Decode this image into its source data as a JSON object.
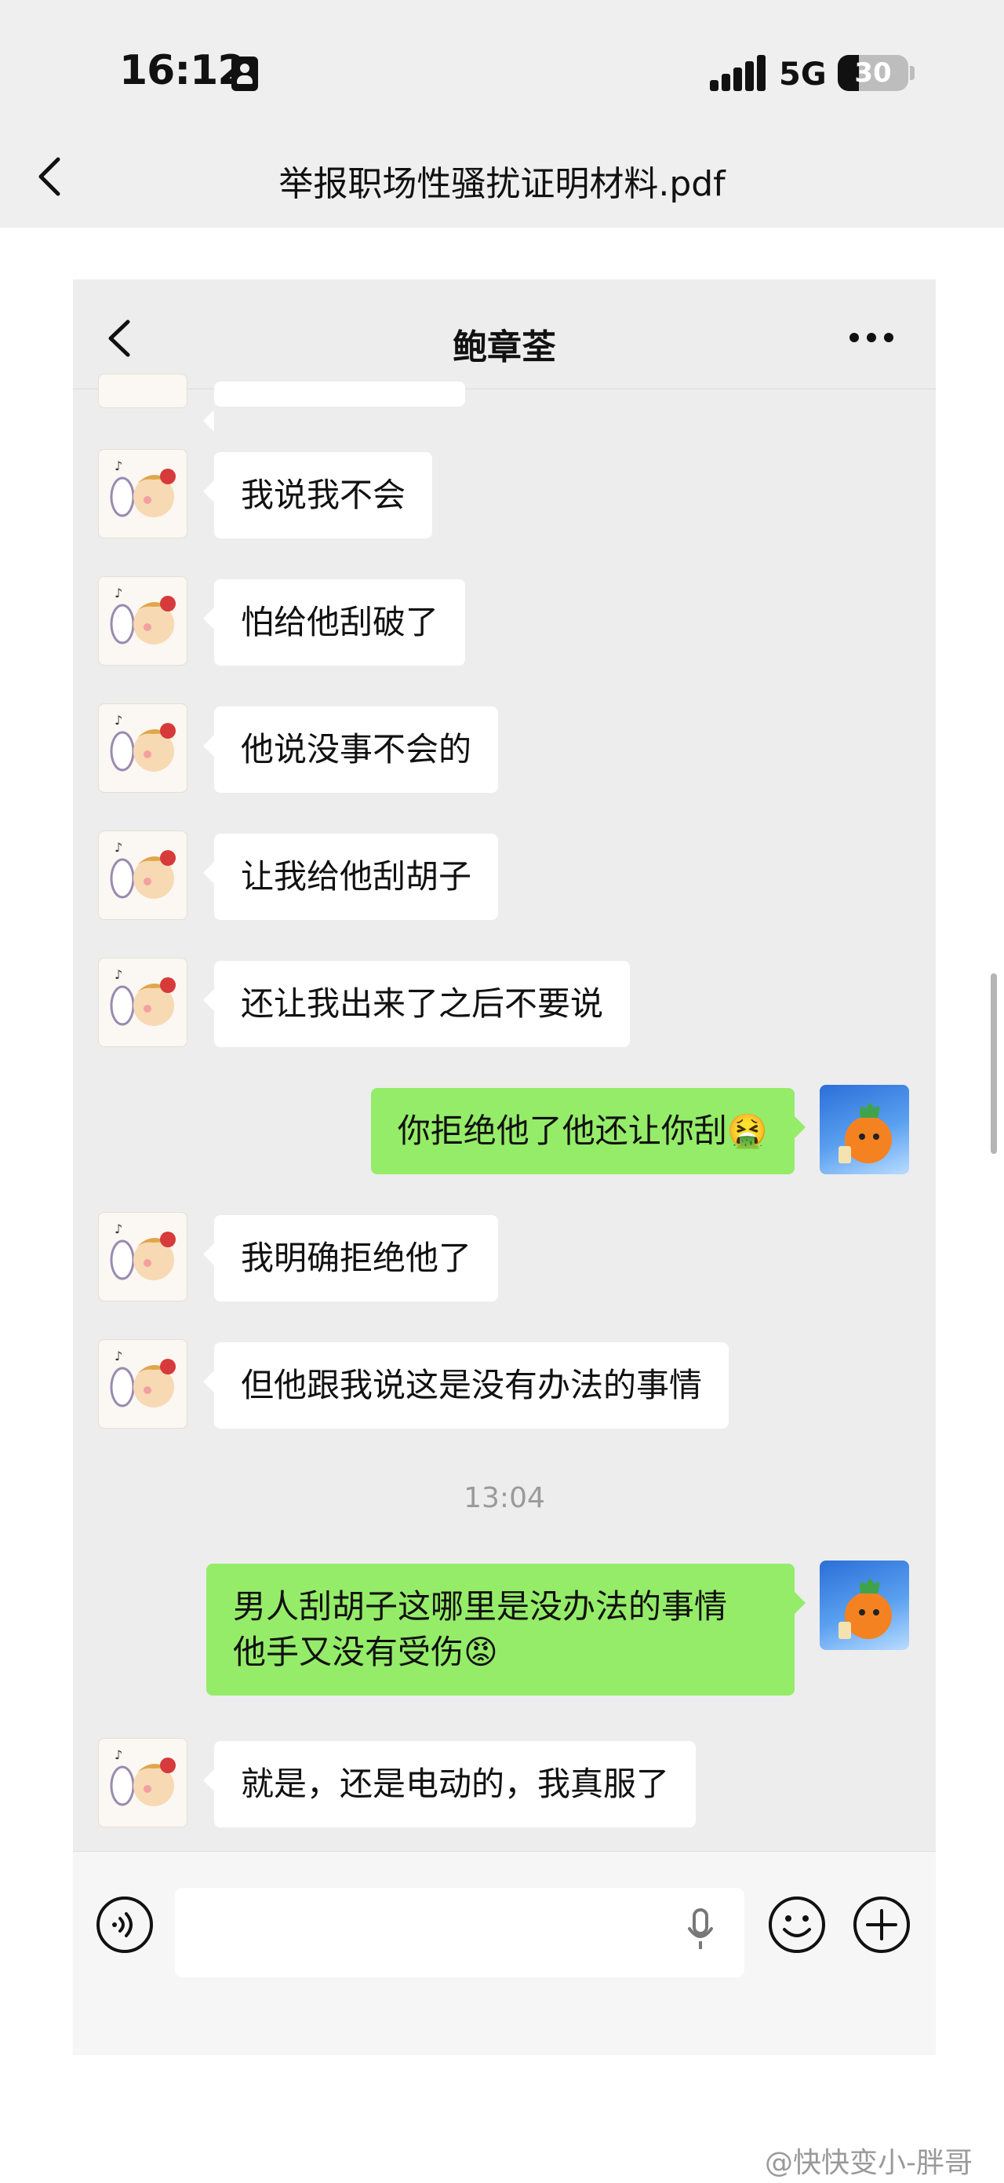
{
  "status_bar": {
    "time": "16:12",
    "network": "5G",
    "battery": "30",
    "battery_level": 0.3
  },
  "pdf_viewer": {
    "title": "举报职场性骚扰证明材料.pdf"
  },
  "chat": {
    "contact_name": "鲍章荃",
    "timestamp": "13:04",
    "messages": [
      {
        "from": "her",
        "text": "我说我不会"
      },
      {
        "from": "her",
        "text": "怕给他刮破了"
      },
      {
        "from": "her",
        "text": "他说没事不会的"
      },
      {
        "from": "her",
        "text": "让我给他刮胡子"
      },
      {
        "from": "her",
        "text": "还让我出来了之后不要说"
      },
      {
        "from": "me",
        "text": "你拒绝他了他还让你刮🤮"
      },
      {
        "from": "her",
        "text": "我明确拒绝他了"
      },
      {
        "from": "her",
        "text": "但他跟我说这是没有办法的事情"
      },
      {
        "from": "me",
        "text": "男人刮胡子这哪里是没办法的事情 他手又没有受伤😡"
      },
      {
        "from": "her",
        "text": "就是，还是电动的，我真服了"
      }
    ]
  },
  "watermark": "@快快变小-胖哥",
  "colors": {
    "outgoing_bubble": "#95ec69",
    "incoming_bubble": "#ffffff",
    "chat_background": "#ededed"
  }
}
